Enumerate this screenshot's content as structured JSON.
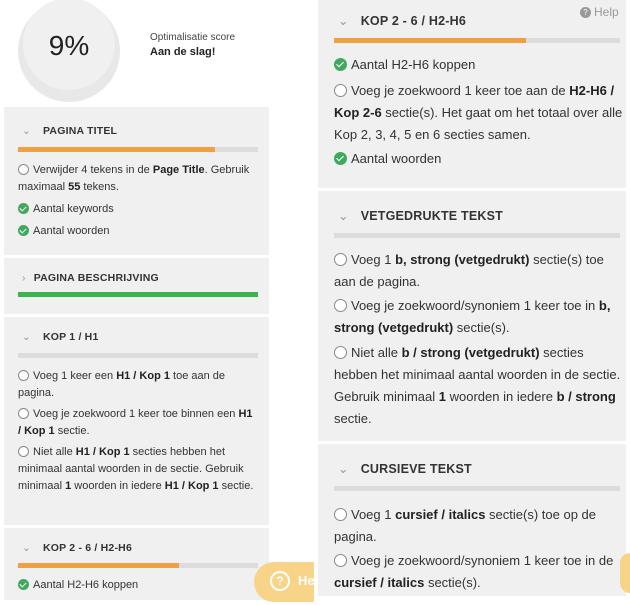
{
  "score": {
    "value": "9%",
    "progress": 0.09,
    "label": "Optimalisatie score",
    "status": "Aan de slag!",
    "arc_color": "#3aab4e"
  },
  "colors": {
    "orange": "#f0a040",
    "green": "#3ab54a",
    "bar_bg": "#dcdcdc"
  },
  "help": {
    "top_label": "Help",
    "button_label": "He",
    "button_icon": "question-icon"
  },
  "left": {
    "pagina_titel": {
      "title": "PAGINA TITEL",
      "progress": 0.82,
      "items": [
        {
          "status": "open",
          "parts": [
            "Verwijder 4 tekens in de ",
            "Page Title",
            ". Gebruik maximaal ",
            "55",
            " tekens."
          ]
        },
        {
          "status": "ok",
          "text": "Aantal keywords"
        },
        {
          "status": "ok",
          "text": "Aantal woorden"
        }
      ]
    },
    "pagina_beschrijving": {
      "title": "PAGINA BESCHRIJVING",
      "progress": 1.0
    },
    "kop1": {
      "title": "KOP 1 / H1",
      "progress": 0,
      "items": [
        {
          "status": "open",
          "parts": [
            "Voeg 1 keer een ",
            "H1 / Kop 1",
            " toe aan de pagina."
          ]
        },
        {
          "status": "open",
          "parts": [
            "Voeg je zoekwoord 1 keer toe binnen een ",
            "H1 / Kop 1",
            " sectie."
          ]
        },
        {
          "status": "open",
          "parts": [
            "Niet alle ",
            "H1 / Kop 1",
            " secties hebben het minimaal aantal woorden in de sectie. Gebruik minimaal ",
            "1",
            " woorden in iedere ",
            "H1 / Kop 1",
            " sectie."
          ]
        }
      ]
    },
    "kop26": {
      "title": "KOP 2 - 6 / H2-H6",
      "progress": 0.67,
      "items": [
        {
          "status": "ok",
          "text": "Aantal H2-H6 koppen"
        }
      ]
    }
  },
  "right": {
    "kop26": {
      "title": "KOP 2 - 6 / H2-H6",
      "progress": 0.67,
      "items": [
        {
          "status": "ok",
          "text": "Aantal H2-H6 koppen"
        },
        {
          "status": "open",
          "parts": [
            "Voeg je zoekwoord 1 keer toe aan de ",
            "H2-H6 / Kop 2-6",
            " sectie(s). Het gaat om het totaal over alle Kop 2, 3, 4, 5 en 6 secties samen."
          ]
        },
        {
          "status": "ok",
          "text": "Aantal woorden"
        }
      ]
    },
    "vetgedrukt": {
      "title": "VETGEDRUKTE TEKST",
      "progress": 0,
      "items": [
        {
          "status": "open",
          "parts": [
            "Voeg 1 ",
            "b, strong (vetgedrukt)",
            " sectie(s) toe aan de pagina."
          ]
        },
        {
          "status": "open",
          "parts": [
            "Voeg je zoekwoord/synoniem 1 keer toe in ",
            "b, strong (vetgedrukt)",
            " sectie(s)."
          ]
        },
        {
          "status": "open",
          "parts": [
            "Niet alle ",
            "b / strong (vetgedrukt)",
            " secties hebben het minimaal aantal woorden in de sectie. Gebruik minimaal ",
            "1",
            " woorden in iedere ",
            "b / strong",
            " sectie."
          ]
        }
      ]
    },
    "cursief": {
      "title": "CURSIEVE TEKST",
      "progress": 0,
      "items": [
        {
          "status": "open",
          "parts": [
            "Voeg 1 ",
            "cursief / italics",
            " sectie(s) toe op de pagina."
          ]
        },
        {
          "status": "open",
          "parts": [
            "Voeg je zoekwoord/synoniem 1 keer toe in de ",
            "cursief / italics",
            " sectie(s)."
          ]
        }
      ]
    }
  }
}
